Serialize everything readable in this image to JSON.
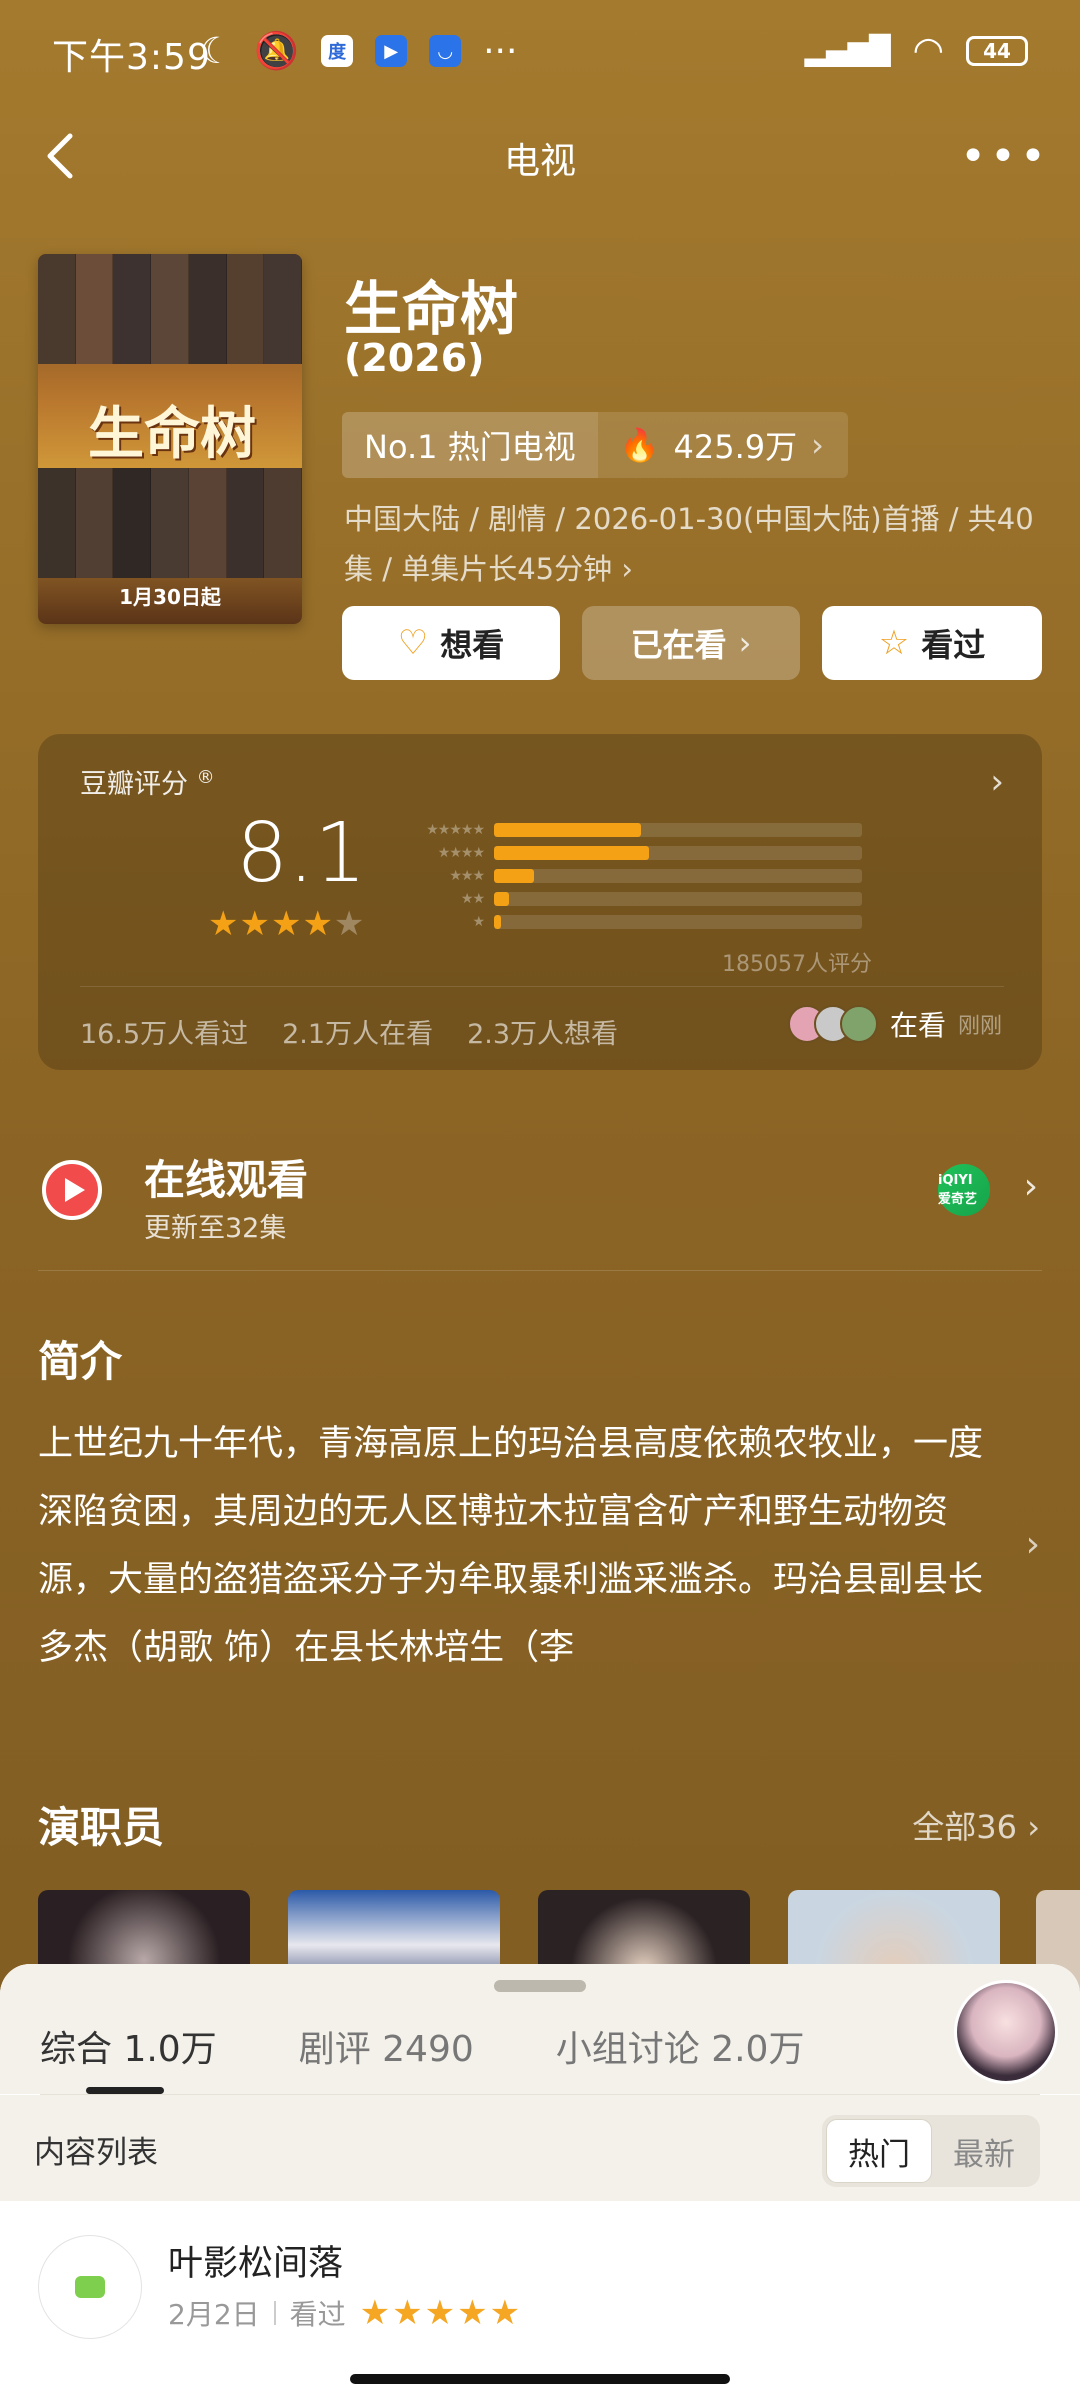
{
  "status_bar": {
    "time": "下午3:59",
    "battery": "44",
    "icons": [
      "moon-icon",
      "bell-off-icon",
      "baidu-icon",
      "video-icon",
      "taobao-icon",
      "more-dots-icon",
      "signal-icon",
      "wifi-icon",
      "battery-icon"
    ]
  },
  "nav": {
    "title": "电视"
  },
  "show": {
    "title": "生命树",
    "year": "(2026)",
    "poster_title": "生命树",
    "poster_date": "1月30日起",
    "rank": "No.1 热门电视",
    "heat": "425.9万",
    "meta": "中国大陆 / 剧情 / 2026-01-30(中国大陆)首播 / 共40集 / 单集片长45分钟"
  },
  "actions": {
    "want": "想看",
    "watching": "已在看",
    "watched": "看过"
  },
  "rating": {
    "label": "豆瓣评分",
    "score": "8.1",
    "stars_text": "★★★★",
    "stars_empty": "★",
    "distribution": [
      {
        "stars": "★★★★★",
        "percent": 40
      },
      {
        "stars": "★★★★",
        "percent": 42
      },
      {
        "stars": "★★★",
        "percent": 11
      },
      {
        "stars": "★★",
        "percent": 4
      },
      {
        "stars": "★",
        "percent": 2
      }
    ],
    "count": "185057人评分",
    "stats": [
      "16.5万人看过",
      "2.1万人在看",
      "2.3万人想看"
    ],
    "friends_status": "在看",
    "friends_time": "刚刚"
  },
  "watch_online": {
    "title": "在线观看",
    "subtitle": "更新至32集",
    "platform": "iQIYI 爱奇艺"
  },
  "synopsis": {
    "title": "简介",
    "text": "上世纪九十年代，青海高原上的玛治县高度依赖农牧业，一度深陷贫困，其周边的无人区博拉木拉富含矿产和野生动物资源，大量的盗猎盗采分子为牟取暴利滥采滥杀。玛治县副县长多杰（胡歌 饰）在县长林培生（李"
  },
  "cast": {
    "title": "演职员",
    "all": "全部36"
  },
  "sheet": {
    "tabs": [
      "综合 1.0万",
      "剧评 2490",
      "小组讨论 2.0万"
    ],
    "list_label": "内容列表",
    "sort_options": [
      "热门",
      "最新"
    ],
    "review": {
      "name": "叶影松间落",
      "date": "2月2日",
      "status": "看过",
      "stars": "★★★★★"
    }
  },
  "colors": {
    "background": "#8f6a27",
    "accent_orange": "#f4a115",
    "play_red": "#f24b4b",
    "iqiyi_green": "#1fc25a"
  }
}
